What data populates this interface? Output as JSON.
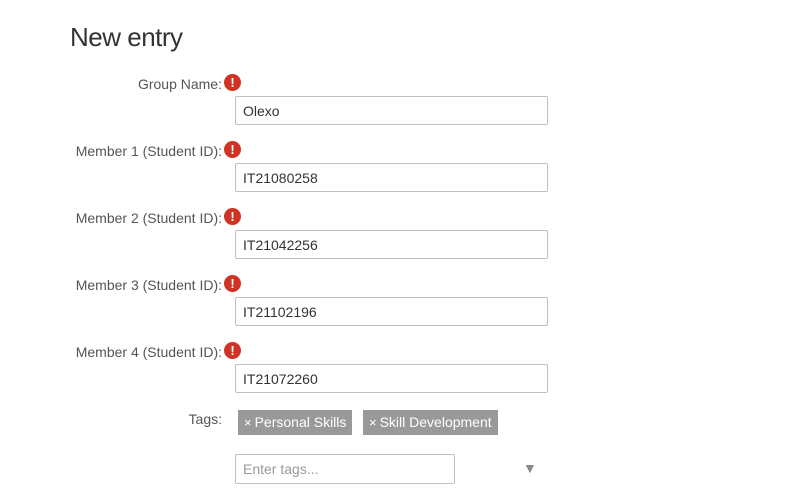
{
  "page": {
    "title": "New entry"
  },
  "fields": [
    {
      "label": "Group Name:",
      "value": "Olexo",
      "required_icon": "!"
    },
    {
      "label": "Member 1 (Student ID):",
      "value": "IT21080258",
      "required_icon": "!"
    },
    {
      "label": "Member 2 (Student ID):",
      "value": "IT21042256",
      "required_icon": "!"
    },
    {
      "label": "Member 3 (Student ID):",
      "value": "IT21102196",
      "required_icon": "!"
    },
    {
      "label": "Member 4 (Student ID):",
      "value": "IT21072260",
      "required_icon": "!"
    }
  ],
  "tags": {
    "label": "Tags:",
    "selected": [
      {
        "remove": "×",
        "text": "Personal Skills"
      },
      {
        "remove": "×",
        "text": "Skill Development"
      }
    ],
    "placeholder": "Enter tags...",
    "dropdown_icon": "▼"
  },
  "colors": {
    "required_icon": "#d03224",
    "tag_chip_background": "#999999",
    "input_border": "#bfbfbf"
  },
  "icons": {
    "required": "exclamation-circle-icon",
    "dropdown": "triangle-down-icon"
  }
}
